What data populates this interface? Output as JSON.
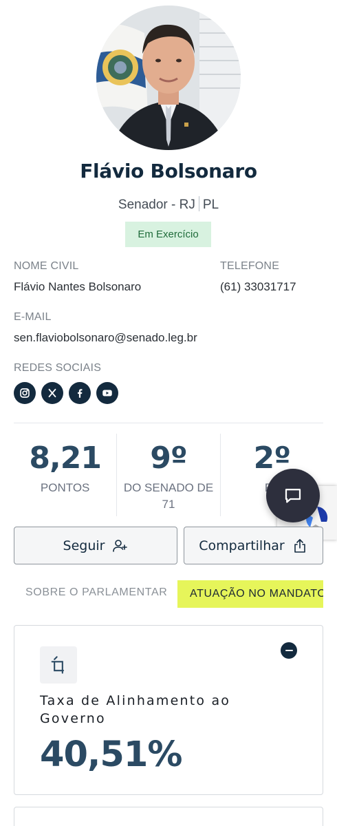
{
  "profile": {
    "name": "Flávio Bolsonaro",
    "role": "Senador - RJ",
    "party": "PL",
    "status": "Em Exercício"
  },
  "info": {
    "civil_name_label": "NOME CIVIL",
    "civil_name": "Flávio Nantes Bolsonaro",
    "phone_label": "TELEFONE",
    "phone": "(61) 33031717",
    "email_label": "E-MAIL",
    "email": "sen.flaviobolsonaro@senado.leg.br",
    "social_label": "REDES SOCIAIS",
    "socials": [
      "instagram-icon",
      "x-icon",
      "facebook-icon",
      "youtube-icon"
    ]
  },
  "stats": [
    {
      "value": "8,21",
      "caption": "PONTOS"
    },
    {
      "value": "9º",
      "caption": "DO SENADO DE 71"
    },
    {
      "value": "2º",
      "caption": "RJ"
    }
  ],
  "actions": {
    "follow_label": "Seguir",
    "share_label": "Compartilhar"
  },
  "tabs": {
    "about": "SOBRE O PARLAMENTAR",
    "activity": "ATUAÇÃO NO MANDATO"
  },
  "alignment_card": {
    "title": "Taxa de Alinhamento ao Governo",
    "value": "40,51%"
  },
  "colors": {
    "navy": "#132a3e",
    "stat_blue": "#2b4a63",
    "status_bg": "#d8f2e0",
    "status_text": "#1f6b3a",
    "tab_highlight": "#e6f55a"
  }
}
